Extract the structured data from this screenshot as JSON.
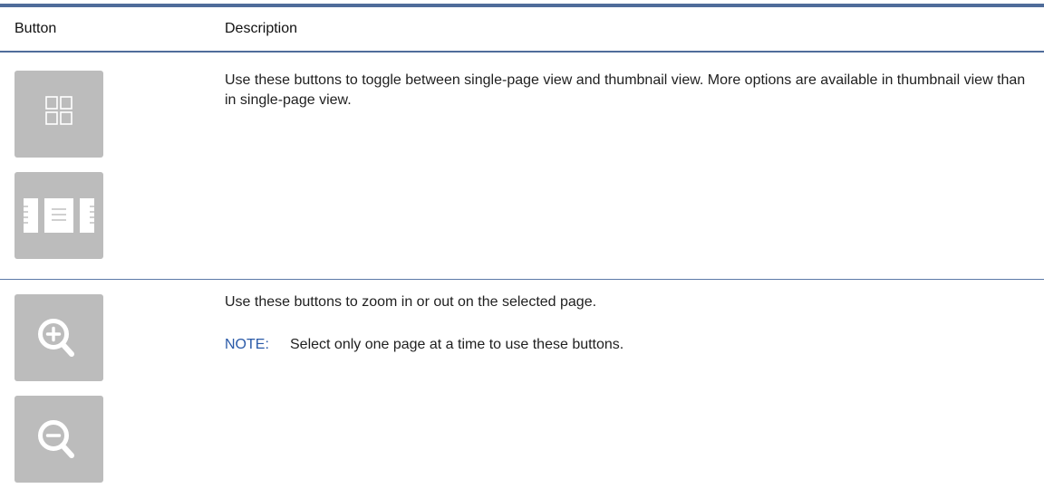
{
  "table": {
    "headers": {
      "button": "Button",
      "description": "Description"
    },
    "rows": [
      {
        "buttons": [
          {
            "icon": "thumbnail-view-icon"
          },
          {
            "icon": "single-page-view-icon"
          }
        ],
        "description": "Use these buttons to toggle between single-page view and thumbnail view. More options are available in thumbnail view than in single-page view."
      },
      {
        "buttons": [
          {
            "icon": "zoom-in-icon"
          },
          {
            "icon": "zoom-out-icon"
          }
        ],
        "description": "Use these buttons to zoom in or out on the selected page.",
        "note_label": "NOTE:",
        "note_text": "Select only one page at a time to use these buttons."
      }
    ]
  },
  "colors": {
    "rule": "#4f6c9a",
    "button_bg": "#bcbcbc",
    "icon_fg": "#ffffff",
    "note_label": "#2a5aa8"
  }
}
